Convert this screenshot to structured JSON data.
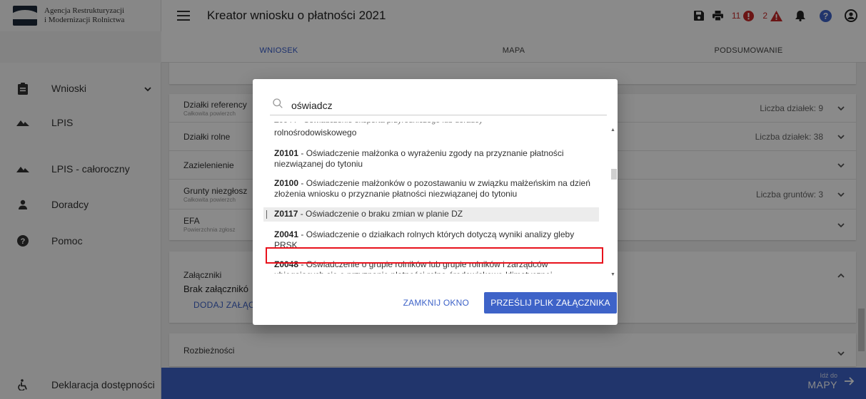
{
  "colors": {
    "primary": "#3e63c8",
    "error": "#c62828",
    "highlight_box": "#e8121c",
    "help": "#3e63c8"
  },
  "logo": {
    "line1": "Agencja Restrukturyzacji",
    "line2": "i Modernizacji Rolnictwa"
  },
  "app": {
    "title": "Kreator wniosku o płatności 2021"
  },
  "toolbar": {
    "errors_count": "11",
    "warnings_count": "2"
  },
  "sidebar": {
    "items": [
      {
        "label": "Wnioski",
        "icon": "clipboard-icon"
      },
      {
        "label": "LPIS",
        "icon": "mountain-icon"
      },
      {
        "label": "LPIS - całoroczny",
        "icon": "mountain-icon"
      },
      {
        "label": "Doradcy",
        "icon": "person-icon"
      },
      {
        "label": "Pomoc",
        "icon": "help-icon"
      }
    ],
    "footer": {
      "label": "Deklaracja dostępności",
      "icon": "accessibility-icon"
    }
  },
  "tabs": [
    "WNIOSEK",
    "MAPA",
    "PODSUMOWANIE"
  ],
  "main": {
    "rows": [
      {
        "title": "Działki referency",
        "sub": "Całkowita powierzch",
        "right": "Liczba działek: 9"
      },
      {
        "title": "Działki rolne",
        "sub": "",
        "right": "Liczba działek: 38"
      },
      {
        "title": "Zazielenienie",
        "sub": "",
        "right": ""
      },
      {
        "title": "Grunty niezgłosz",
        "sub": "Całkowita powierzch",
        "right": "Liczba gruntów: 3"
      },
      {
        "title": "EFA",
        "sub": "Powierzchnia zgłosz",
        "right": ""
      }
    ],
    "attachments": {
      "title": "Załączniki",
      "empty": "Brak załącznikó",
      "add": "DODAJ ZAŁĄC"
    },
    "discrepancies": "Rozbieżności"
  },
  "bottom": {
    "go_to_small": "Idź do",
    "go_to_big": "MAPY"
  },
  "modal": {
    "search_value": "oświadcz",
    "options": [
      {
        "code": "",
        "text": "rolnośrodowiskowego"
      },
      {
        "code": "Z0101",
        "text": " - Oświadczenie małżonka o wyrażeniu zgody na przyznanie płatności niezwiązanej do tytoniu"
      },
      {
        "code": "Z0100",
        "text": " - Oświadczenie małżonków o pozostawaniu w związku małżeńskim na dzień złożenia wniosku o przyznanie płatności niezwiązanej do tytoniu"
      },
      {
        "code": "Z0117",
        "text": " - Oświadczenie o braku zmian w planie DZ"
      },
      {
        "code": "Z0041",
        "text": " - Oświadczenie o działkach rolnych których dotyczą wyniki analizy gleby PRSK"
      },
      {
        "code": "Z0048",
        "text": " - Oświadczenie o grupie rolników lub grupie rolników i zarządców ubiegających się o przyznanie płatności rolno-środowiskowo-klimatycznej"
      }
    ],
    "close_label": "ZAMKNIJ OKNO",
    "send_label": "PRZEŚLIJ PLIK ZAŁĄCZNIKA"
  }
}
